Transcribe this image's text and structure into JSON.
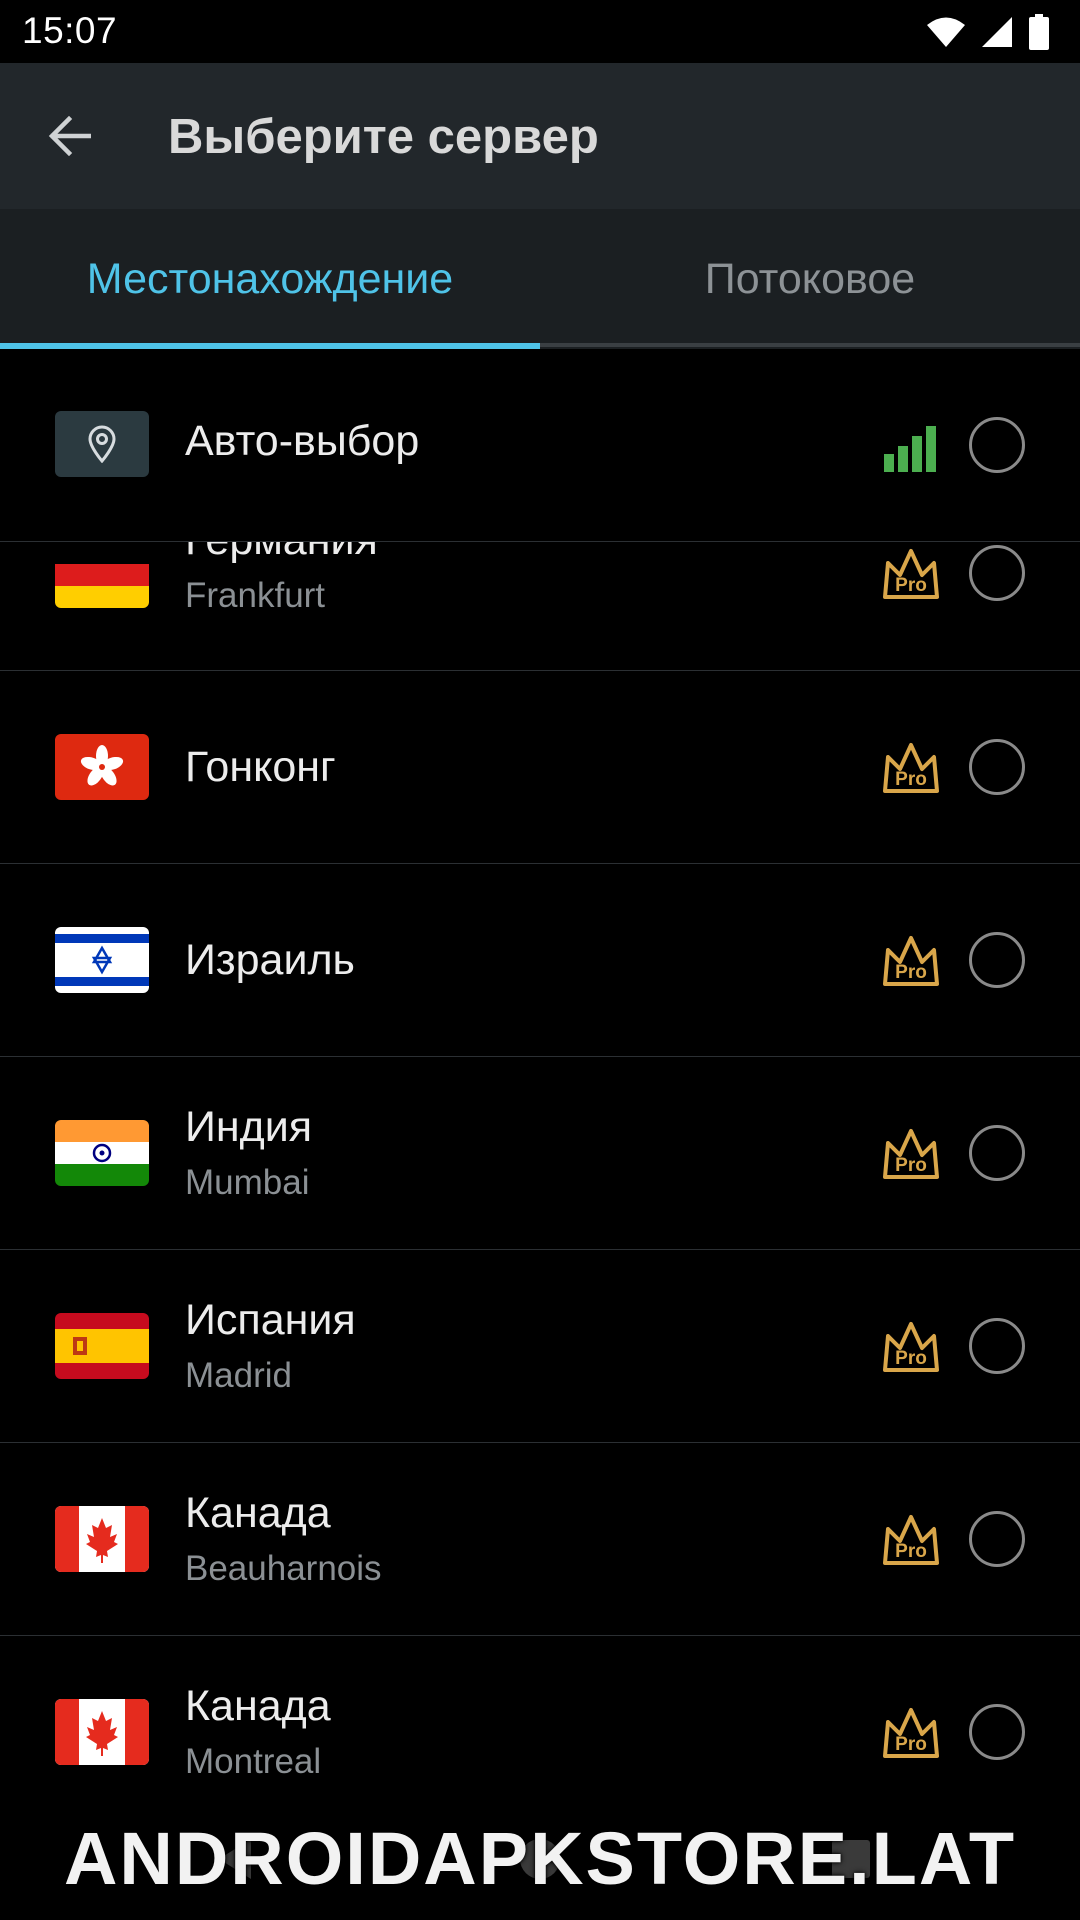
{
  "status_bar": {
    "time": "15:07",
    "icons": [
      "wifi-icon",
      "signal-icon",
      "battery-icon"
    ]
  },
  "app_bar": {
    "title": "Выберите сервер",
    "back_icon": "arrow-back-icon"
  },
  "tabs": [
    {
      "label": "Местонахождение",
      "selected": true
    },
    {
      "label": "Потоковое",
      "selected": false
    }
  ],
  "colors": {
    "accent": "#4fc3e8",
    "pro_gold": "#d9a64a",
    "signal_green": "#4caf50",
    "app_bar": "#22272b"
  },
  "auto_select": {
    "label": "Авто-выбор",
    "icon": "location-pin-icon",
    "signal_icon": "signal-bars-icon"
  },
  "servers": [
    {
      "country": "Германия",
      "city": "Frankfurt",
      "flag": "germany",
      "badge": "Pro"
    },
    {
      "country": "Гонконг",
      "city": "",
      "flag": "hong-kong",
      "badge": "Pro"
    },
    {
      "country": "Израиль",
      "city": "",
      "flag": "israel",
      "badge": "Pro"
    },
    {
      "country": "Индия",
      "city": "Mumbai",
      "flag": "india",
      "badge": "Pro"
    },
    {
      "country": "Испания",
      "city": "Madrid",
      "flag": "spain",
      "badge": "Pro"
    },
    {
      "country": "Канада",
      "city": "Beauharnois",
      "flag": "canada",
      "badge": "Pro"
    },
    {
      "country": "Канада",
      "city": "Montreal",
      "flag": "canada",
      "badge": "Pro"
    }
  ],
  "watermark": "ANDROIDAPKSTORE.LAT"
}
